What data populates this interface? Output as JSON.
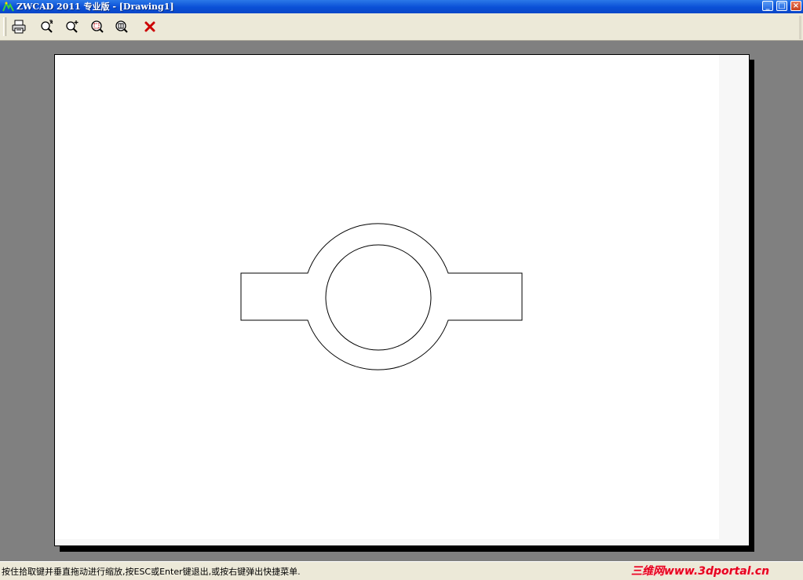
{
  "window": {
    "title": "ZWCAD 2011 专业版 - [Drawing1]",
    "buttons": {
      "minimize": "_",
      "maximize": "□",
      "close": "×"
    }
  },
  "toolbar": {
    "items": [
      {
        "name": "print-icon"
      },
      {
        "name": "zoom-realtime-icon"
      },
      {
        "name": "zoom-in-icon"
      },
      {
        "name": "zoom-window-icon"
      },
      {
        "name": "zoom-extents-icon"
      },
      {
        "name": "close-preview-icon"
      }
    ]
  },
  "status": {
    "message": "按住拾取键并垂直拖动进行缩放,按ESC或Enter键退出,或按右键弹出快捷菜单.",
    "watermark": "三维网www.3dportal.cn"
  },
  "colors": {
    "titlebar": "#0a4fd6",
    "workspace": "#808080",
    "close_red": "#cc0000",
    "watermark": "#e6001e"
  }
}
